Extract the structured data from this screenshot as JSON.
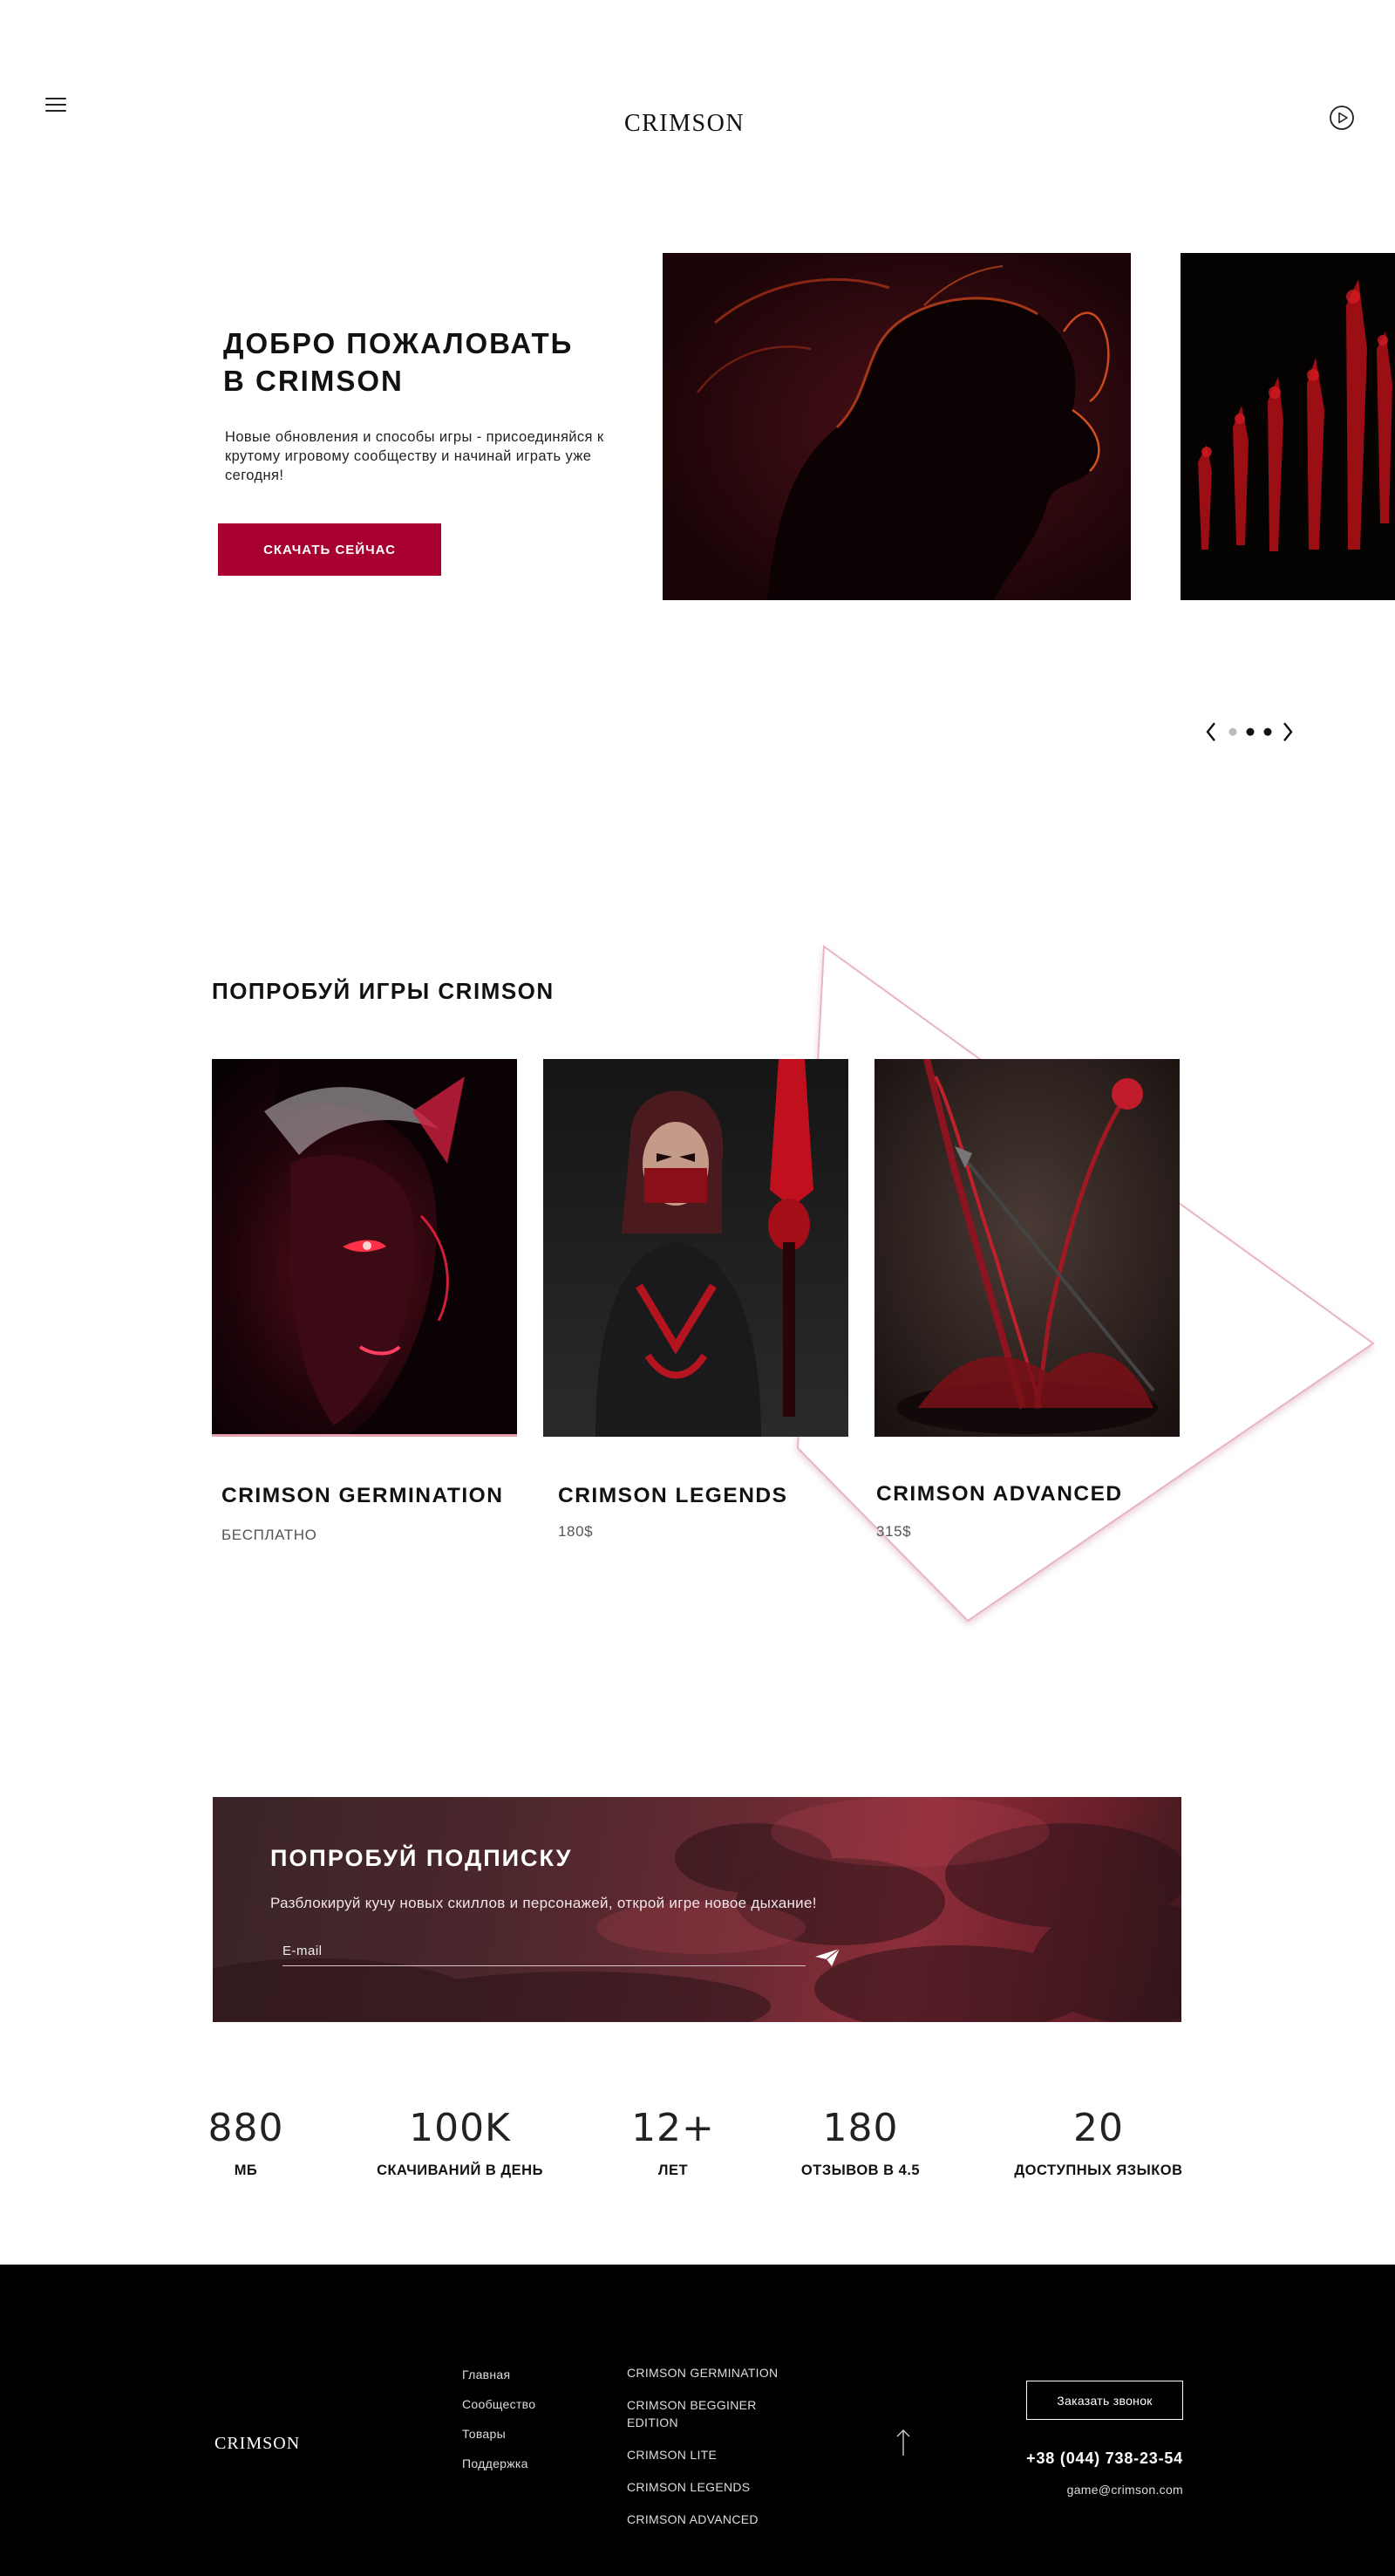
{
  "header": {
    "logo": "CRIMSON",
    "menu_icon": "hamburger-menu-icon",
    "play_icon": "play-circle-icon"
  },
  "hero": {
    "title_line1": "ДОБРО ПОЖАЛОВАТЬ",
    "title_line2": "В CRIMSON",
    "text": "Новые обновления и способы игры - присоединяйся к крутому игровому сообществу и начинай играть уже сегодня!",
    "button": "СКАЧАТЬ СЕЙЧАС",
    "slider": {
      "dots": 3,
      "active": 0
    }
  },
  "games": {
    "title": "ПОПРОБУЙ ИГРЫ CRIMSON",
    "items": [
      {
        "name": "CRIMSON GERMINATION",
        "price": "БЕСПЛАТНО"
      },
      {
        "name": "CRIMSON LEGENDS",
        "price": "180$"
      },
      {
        "name": "CRIMSON ADVANCED",
        "price": "315$"
      }
    ]
  },
  "subscribe": {
    "title": "ПОПРОБУЙ ПОДПИСКУ",
    "text": "Разблокируй кучу новых скиллов и персонажей, открой игре новое дыхание!",
    "placeholder": "E-mail"
  },
  "stats": [
    {
      "value": "880",
      "label": "МБ"
    },
    {
      "value": "100K",
      "label": "СКАЧИВАНИЙ В ДЕНЬ"
    },
    {
      "value": "12+",
      "label": "ЛЕТ"
    },
    {
      "value": "180",
      "label": "ОТЗЫВОВ В 4.5"
    },
    {
      "value": "20",
      "label": "ДОСТУПНЫХ ЯЗЫКОВ"
    }
  ],
  "footer": {
    "logo": "CRIMSON",
    "nav": [
      "Главная",
      "Сообщество",
      "Товары",
      "Поддержка"
    ],
    "games": [
      "CRIMSON GERMINATION",
      "CRIMSON BEGGINER EDITION",
      "CRIMSON LITE",
      "CRIMSON LEGENDS",
      "CRIMSON ADVANCED"
    ],
    "call_button": "Заказать звонок",
    "phone": "+38 (044) 738-23-54",
    "email": "game@crimson.com"
  },
  "colors": {
    "accent": "#a8002f",
    "footer_bg": "#000000"
  }
}
